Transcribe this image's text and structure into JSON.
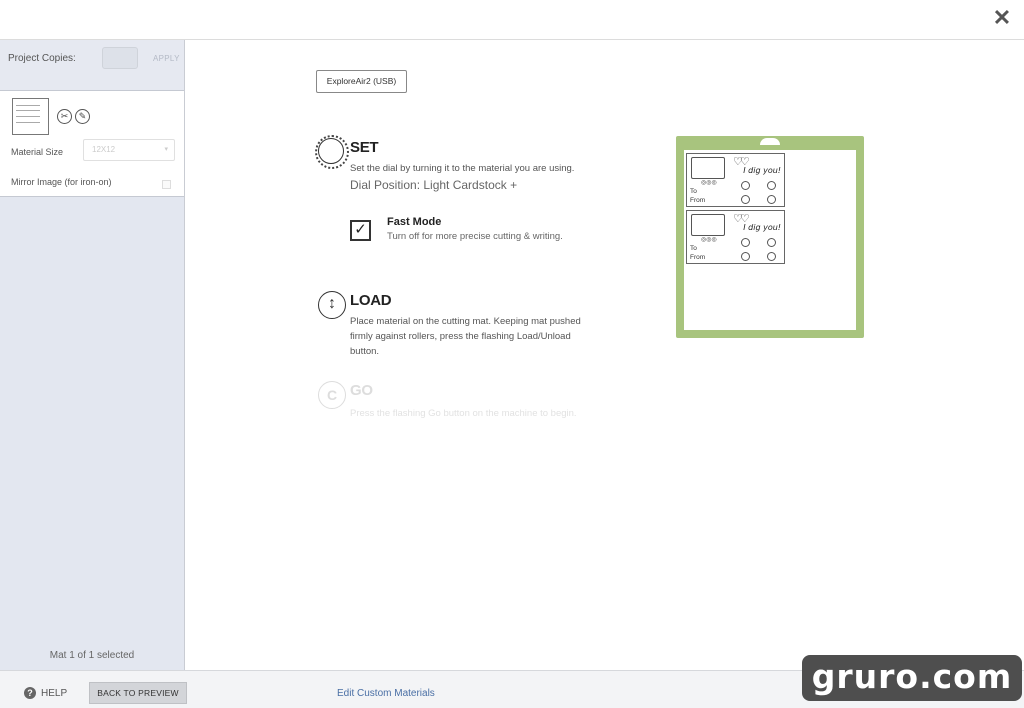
{
  "header": {
    "close_icon": "close-icon"
  },
  "sidebar": {
    "project_copies_label": "Project Copies:",
    "apply_label": "APPLY",
    "material_size_label": "Material Size",
    "material_size_value": "12X12",
    "mirror_label": "Mirror Image (for iron-on)",
    "mat_status": "Mat 1 of 1 selected"
  },
  "main": {
    "machine_label": "ExploreAir2 (USB)",
    "set": {
      "title": "SET",
      "desc": "Set the dial by turning it to the material you are using.",
      "dial_position": "Dial Position: Light Cardstock +",
      "fast_mode_title": "Fast Mode",
      "fast_mode_desc": "Turn off for more precise cutting & writing.",
      "fast_mode_checked": true
    },
    "load": {
      "title": "LOAD",
      "desc": "Place material on the cutting mat. Keeping mat pushed firmly against rollers, press the flashing Load/Unload button."
    },
    "go": {
      "title": "GO",
      "desc": "Press the flashing Go button on the machine to begin."
    },
    "mat_preview": {
      "card_text": "I dig you!",
      "to_label": "To",
      "from_label": "From"
    }
  },
  "footer": {
    "help_label": "HELP",
    "back_label": "BACK TO PREVIEW",
    "edit_link": "Edit Custom Materials"
  },
  "watermark": "gruro.com",
  "colors": {
    "sidebar_bg": "#e3e7f0",
    "mat_green": "#a8c47e",
    "link_blue": "#4a6fa5"
  }
}
